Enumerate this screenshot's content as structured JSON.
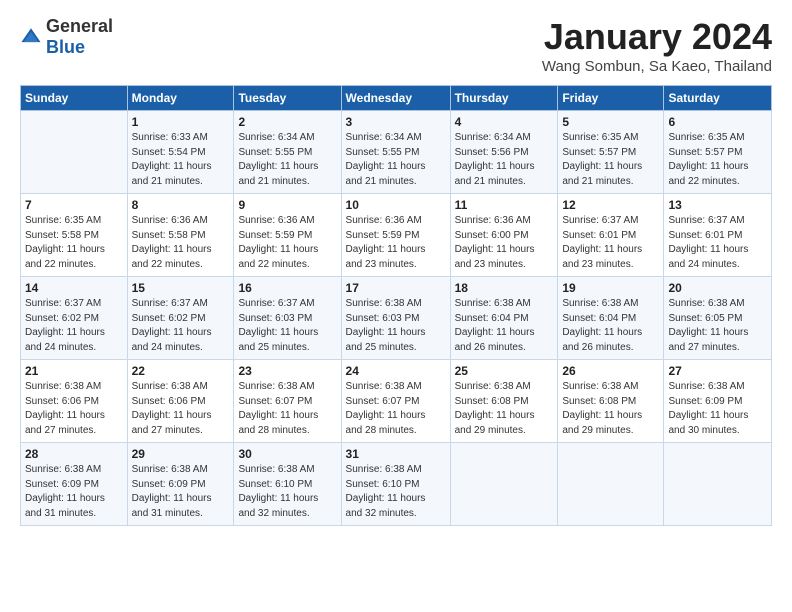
{
  "header": {
    "logo_general": "General",
    "logo_blue": "Blue",
    "month": "January 2024",
    "location": "Wang Sombun, Sa Kaeo, Thailand"
  },
  "days_of_week": [
    "Sunday",
    "Monday",
    "Tuesday",
    "Wednesday",
    "Thursday",
    "Friday",
    "Saturday"
  ],
  "weeks": [
    [
      {
        "num": "",
        "detail": ""
      },
      {
        "num": "1",
        "detail": "Sunrise: 6:33 AM\nSunset: 5:54 PM\nDaylight: 11 hours\nand 21 minutes."
      },
      {
        "num": "2",
        "detail": "Sunrise: 6:34 AM\nSunset: 5:55 PM\nDaylight: 11 hours\nand 21 minutes."
      },
      {
        "num": "3",
        "detail": "Sunrise: 6:34 AM\nSunset: 5:55 PM\nDaylight: 11 hours\nand 21 minutes."
      },
      {
        "num": "4",
        "detail": "Sunrise: 6:34 AM\nSunset: 5:56 PM\nDaylight: 11 hours\nand 21 minutes."
      },
      {
        "num": "5",
        "detail": "Sunrise: 6:35 AM\nSunset: 5:57 PM\nDaylight: 11 hours\nand 21 minutes."
      },
      {
        "num": "6",
        "detail": "Sunrise: 6:35 AM\nSunset: 5:57 PM\nDaylight: 11 hours\nand 22 minutes."
      }
    ],
    [
      {
        "num": "7",
        "detail": "Sunrise: 6:35 AM\nSunset: 5:58 PM\nDaylight: 11 hours\nand 22 minutes."
      },
      {
        "num": "8",
        "detail": "Sunrise: 6:36 AM\nSunset: 5:58 PM\nDaylight: 11 hours\nand 22 minutes."
      },
      {
        "num": "9",
        "detail": "Sunrise: 6:36 AM\nSunset: 5:59 PM\nDaylight: 11 hours\nand 22 minutes."
      },
      {
        "num": "10",
        "detail": "Sunrise: 6:36 AM\nSunset: 5:59 PM\nDaylight: 11 hours\nand 23 minutes."
      },
      {
        "num": "11",
        "detail": "Sunrise: 6:36 AM\nSunset: 6:00 PM\nDaylight: 11 hours\nand 23 minutes."
      },
      {
        "num": "12",
        "detail": "Sunrise: 6:37 AM\nSunset: 6:01 PM\nDaylight: 11 hours\nand 23 minutes."
      },
      {
        "num": "13",
        "detail": "Sunrise: 6:37 AM\nSunset: 6:01 PM\nDaylight: 11 hours\nand 24 minutes."
      }
    ],
    [
      {
        "num": "14",
        "detail": "Sunrise: 6:37 AM\nSunset: 6:02 PM\nDaylight: 11 hours\nand 24 minutes."
      },
      {
        "num": "15",
        "detail": "Sunrise: 6:37 AM\nSunset: 6:02 PM\nDaylight: 11 hours\nand 24 minutes."
      },
      {
        "num": "16",
        "detail": "Sunrise: 6:37 AM\nSunset: 6:03 PM\nDaylight: 11 hours\nand 25 minutes."
      },
      {
        "num": "17",
        "detail": "Sunrise: 6:38 AM\nSunset: 6:03 PM\nDaylight: 11 hours\nand 25 minutes."
      },
      {
        "num": "18",
        "detail": "Sunrise: 6:38 AM\nSunset: 6:04 PM\nDaylight: 11 hours\nand 26 minutes."
      },
      {
        "num": "19",
        "detail": "Sunrise: 6:38 AM\nSunset: 6:04 PM\nDaylight: 11 hours\nand 26 minutes."
      },
      {
        "num": "20",
        "detail": "Sunrise: 6:38 AM\nSunset: 6:05 PM\nDaylight: 11 hours\nand 27 minutes."
      }
    ],
    [
      {
        "num": "21",
        "detail": "Sunrise: 6:38 AM\nSunset: 6:06 PM\nDaylight: 11 hours\nand 27 minutes."
      },
      {
        "num": "22",
        "detail": "Sunrise: 6:38 AM\nSunset: 6:06 PM\nDaylight: 11 hours\nand 27 minutes."
      },
      {
        "num": "23",
        "detail": "Sunrise: 6:38 AM\nSunset: 6:07 PM\nDaylight: 11 hours\nand 28 minutes."
      },
      {
        "num": "24",
        "detail": "Sunrise: 6:38 AM\nSunset: 6:07 PM\nDaylight: 11 hours\nand 28 minutes."
      },
      {
        "num": "25",
        "detail": "Sunrise: 6:38 AM\nSunset: 6:08 PM\nDaylight: 11 hours\nand 29 minutes."
      },
      {
        "num": "26",
        "detail": "Sunrise: 6:38 AM\nSunset: 6:08 PM\nDaylight: 11 hours\nand 29 minutes."
      },
      {
        "num": "27",
        "detail": "Sunrise: 6:38 AM\nSunset: 6:09 PM\nDaylight: 11 hours\nand 30 minutes."
      }
    ],
    [
      {
        "num": "28",
        "detail": "Sunrise: 6:38 AM\nSunset: 6:09 PM\nDaylight: 11 hours\nand 31 minutes."
      },
      {
        "num": "29",
        "detail": "Sunrise: 6:38 AM\nSunset: 6:09 PM\nDaylight: 11 hours\nand 31 minutes."
      },
      {
        "num": "30",
        "detail": "Sunrise: 6:38 AM\nSunset: 6:10 PM\nDaylight: 11 hours\nand 32 minutes."
      },
      {
        "num": "31",
        "detail": "Sunrise: 6:38 AM\nSunset: 6:10 PM\nDaylight: 11 hours\nand 32 minutes."
      },
      {
        "num": "",
        "detail": ""
      },
      {
        "num": "",
        "detail": ""
      },
      {
        "num": "",
        "detail": ""
      }
    ]
  ]
}
